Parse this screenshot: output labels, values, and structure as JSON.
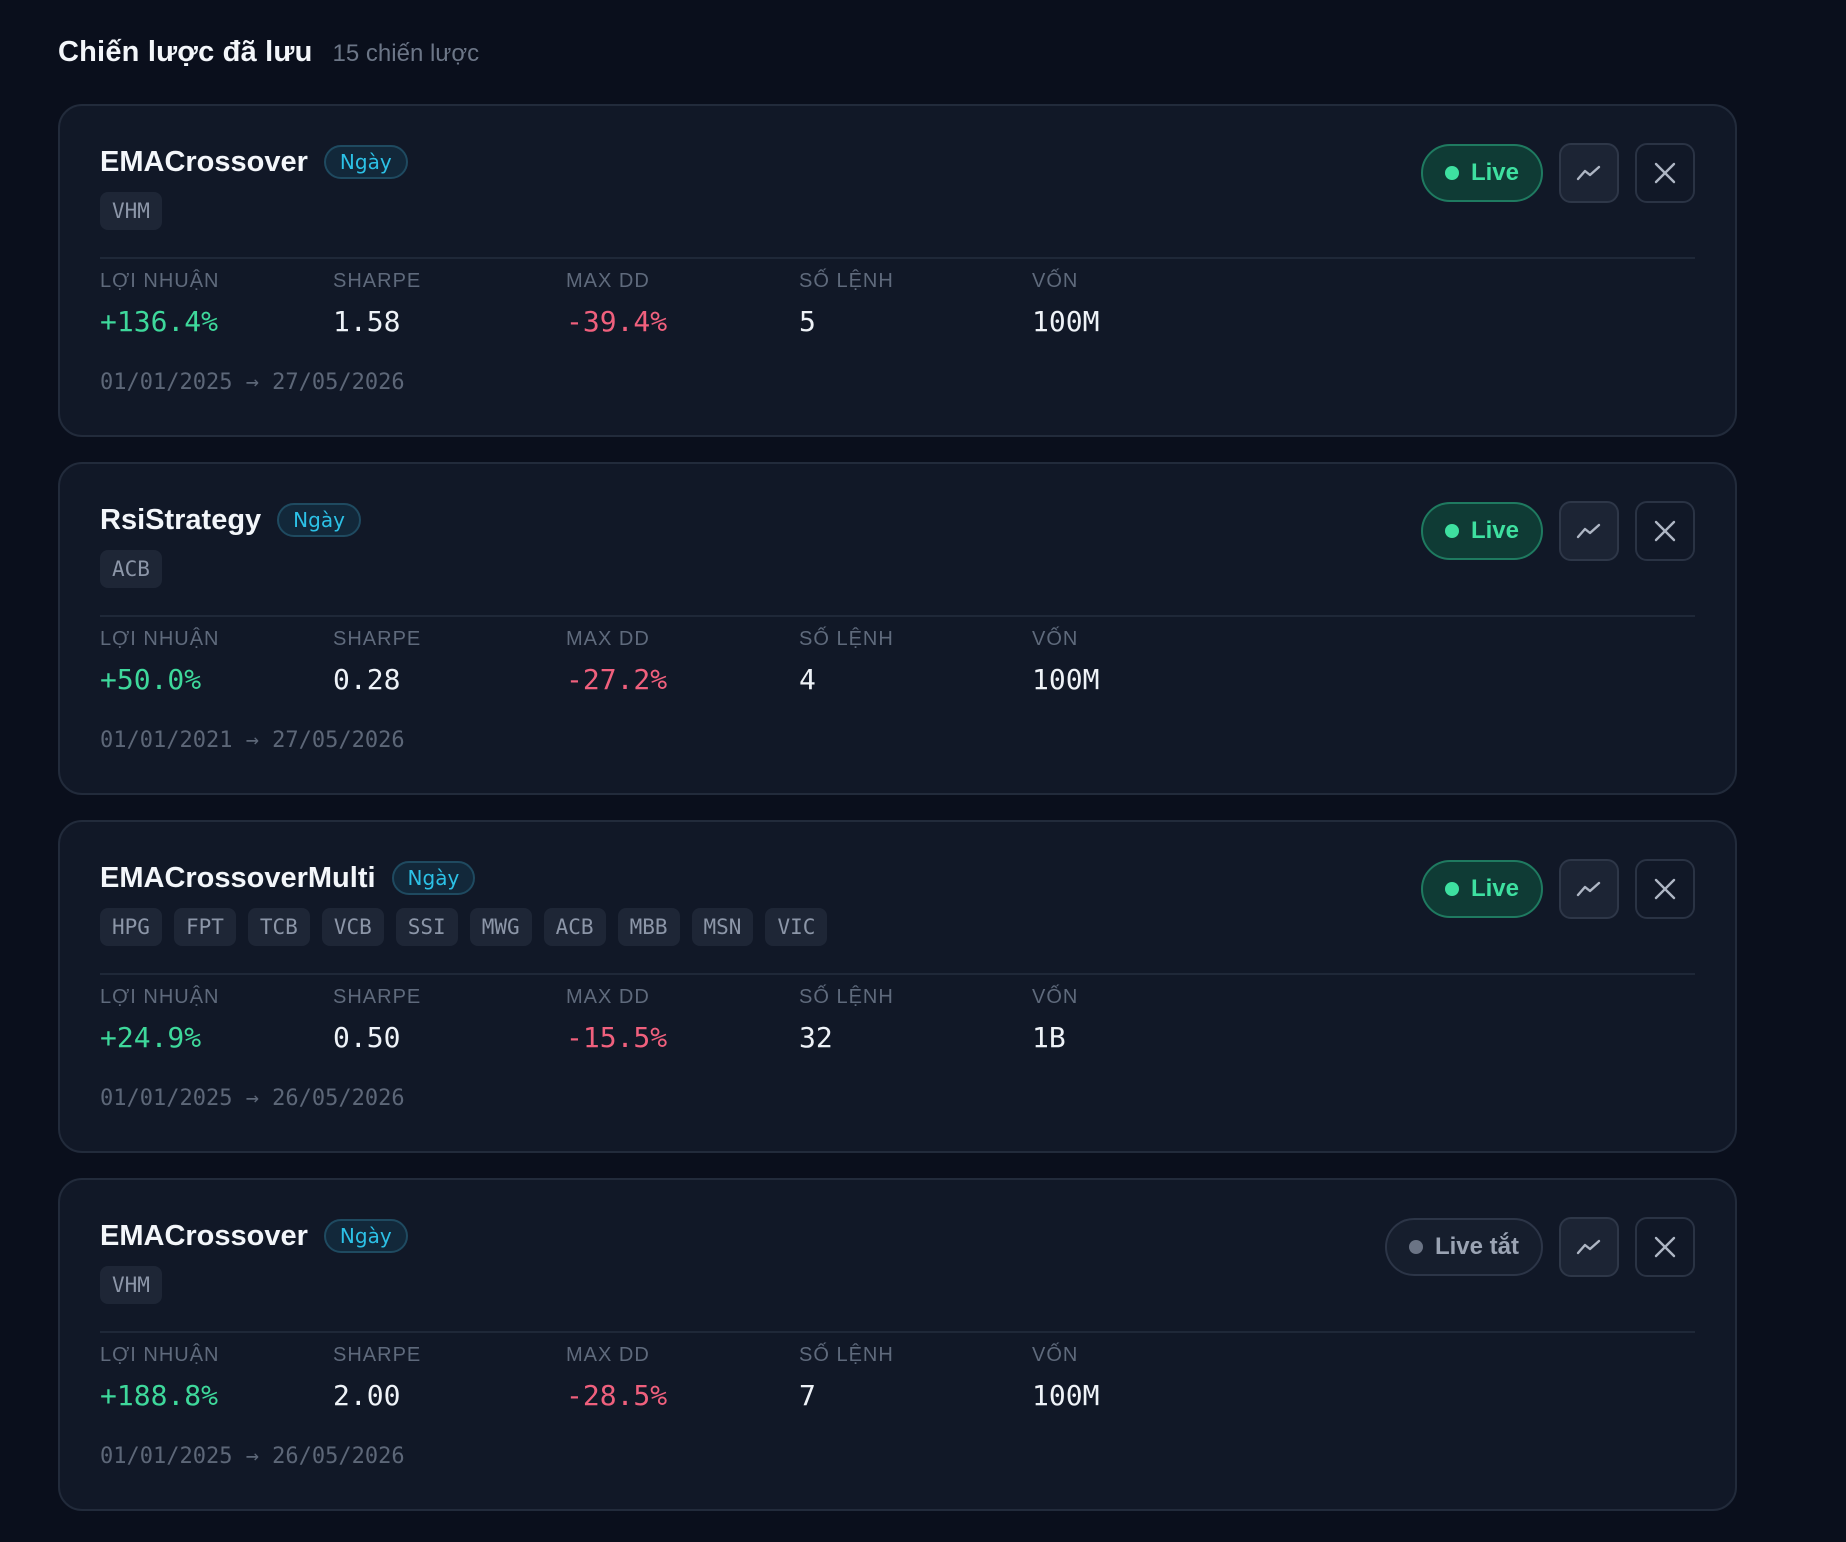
{
  "header": {
    "title": "Chiến lược đã lưu",
    "count": "15 chiến lược"
  },
  "labels": {
    "profit": "LỢI NHUẬN",
    "sharpe": "SHARPE",
    "max_dd": "MAX DD",
    "trades": "SỐ LỆNH",
    "capital": "VỐN",
    "live_on": "Live",
    "live_off": "Live tắt"
  },
  "icons": {
    "chart": "line-chart-icon",
    "close": "close-icon"
  },
  "colors": {
    "background": "#0a0f1c",
    "card": "#111827",
    "positive": "#3ed89b",
    "negative": "#f0607d",
    "timeframe": "#2cc1e6",
    "live": "#3ee0a0"
  },
  "strategies": [
    {
      "name": "EMACrossover",
      "timeframe": "Ngày",
      "symbols": [
        "VHM"
      ],
      "profit": "+136.4%",
      "sharpe": "1.58",
      "max_dd": "-39.4%",
      "trades": "5",
      "capital": "100M",
      "date_range": "01/01/2025 → 27/05/2026",
      "live": true
    },
    {
      "name": "RsiStrategy",
      "timeframe": "Ngày",
      "symbols": [
        "ACB"
      ],
      "profit": "+50.0%",
      "sharpe": "0.28",
      "max_dd": "-27.2%",
      "trades": "4",
      "capital": "100M",
      "date_range": "01/01/2021 → 27/05/2026",
      "live": true
    },
    {
      "name": "EMACrossoverMulti",
      "timeframe": "Ngày",
      "symbols": [
        "HPG",
        "FPT",
        "TCB",
        "VCB",
        "SSI",
        "MWG",
        "ACB",
        "MBB",
        "MSN",
        "VIC"
      ],
      "profit": "+24.9%",
      "sharpe": "0.50",
      "max_dd": "-15.5%",
      "trades": "32",
      "capital": "1B",
      "date_range": "01/01/2025 → 26/05/2026",
      "live": true
    },
    {
      "name": "EMACrossover",
      "timeframe": "Ngày",
      "symbols": [
        "VHM"
      ],
      "profit": "+188.8%",
      "sharpe": "2.00",
      "max_dd": "-28.5%",
      "trades": "7",
      "capital": "100M",
      "date_range": "01/01/2025 → 26/05/2026",
      "live": false
    }
  ]
}
